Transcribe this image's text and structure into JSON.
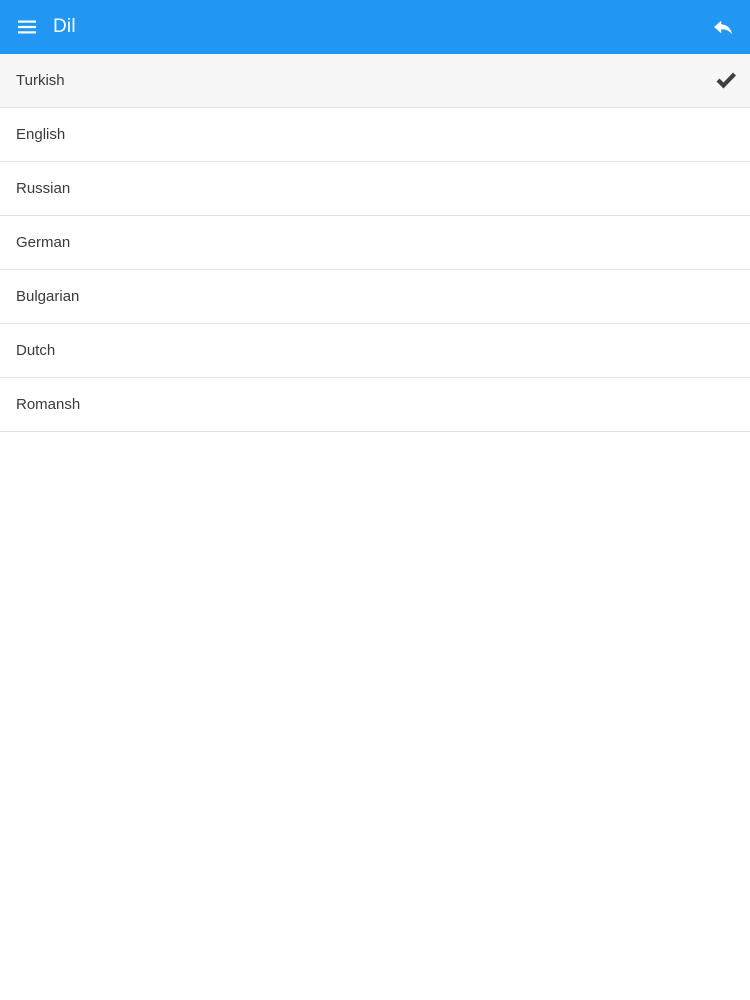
{
  "header": {
    "title": "Dil",
    "menu_icon": "menu-icon",
    "back_icon": "reply-icon"
  },
  "languages": {
    "items": [
      {
        "label": "Turkish",
        "selected": true
      },
      {
        "label": "English",
        "selected": false
      },
      {
        "label": "Russian",
        "selected": false
      },
      {
        "label": "German",
        "selected": false
      },
      {
        "label": "Bulgarian",
        "selected": false
      },
      {
        "label": "Dutch",
        "selected": false
      },
      {
        "label": "Romansh",
        "selected": false
      }
    ]
  },
  "colors": {
    "toolbar": "#2196f3",
    "divider": "#e2e2e2",
    "selected_row": "#f6f6f6",
    "text": "#3a3a3a"
  }
}
